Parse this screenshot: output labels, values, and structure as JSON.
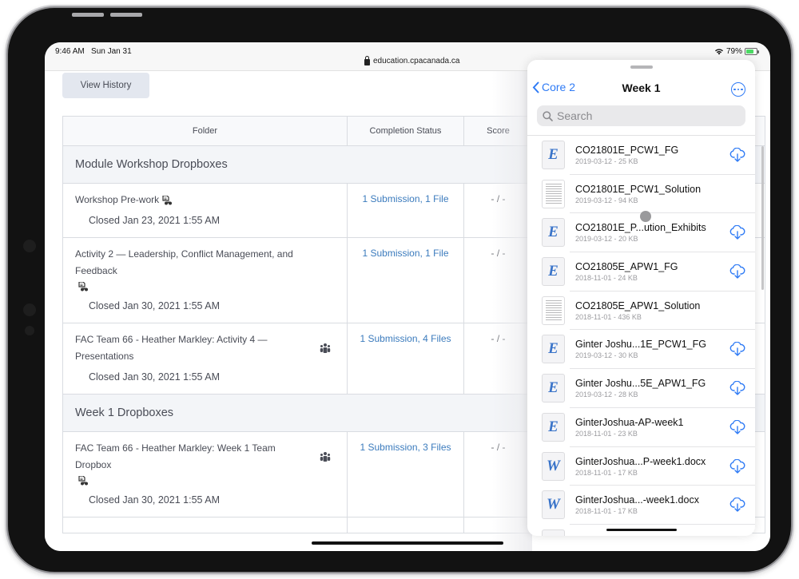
{
  "status_bar": {
    "time": "9:46 AM",
    "date": "Sun Jan 31",
    "url": "education.cpacanada.ca",
    "battery": "79%",
    "battery_level": 0.79
  },
  "page": {
    "view_history_label": "View History",
    "table": {
      "headers": [
        "Folder",
        "Completion Status",
        "Score"
      ],
      "sections": [
        {
          "title": "Module Workshop Dropboxes",
          "rows": [
            {
              "folder": "Workshop Pre-work",
              "closed": "Closed Jan 23, 2021 1:55 AM",
              "status": "1 Submission, 1 File",
              "score": "- / -",
              "icons": [
                "submission-icon"
              ]
            },
            {
              "folder": "Activity 2 — Leadership, Conflict Management, and Feedback",
              "closed": "Closed Jan 30, 2021 1:55 AM",
              "status": "1 Submission, 1 File",
              "score": "- / -",
              "icons": [
                "submission-icon"
              ]
            },
            {
              "folder": "FAC Team 66 - Heather Markley: Activity 4 — Presentations",
              "closed": "Closed Jan 30, 2021 1:55 AM",
              "status": "1 Submission, 4 Files",
              "score": "- / -",
              "icons": [
                "group-icon"
              ]
            }
          ]
        },
        {
          "title": "Week 1 Dropboxes",
          "rows": [
            {
              "folder": "FAC Team 66 - Heather Markley: Week 1 Team Dropbox",
              "closed": "Closed Jan 30, 2021 1:55 AM",
              "status": "1 Submission, 3 Files",
              "score": "- / -",
              "icons": [
                "group-icon",
                "submission-icon"
              ]
            }
          ]
        }
      ]
    }
  },
  "files_panel": {
    "back_label": "Core 2",
    "title": "Week 1",
    "search_placeholder": "Search",
    "files": [
      {
        "name": "CO21801E_PCW1_FG",
        "meta": "2019-03-12 - 25 KB",
        "thumb": "E",
        "cloud": true
      },
      {
        "name": "CO21801E_PCW1_Solution",
        "meta": "2019-03-12 - 94 KB",
        "thumb": "doc",
        "cloud": false
      },
      {
        "name": "CO21801E_P...ution_Exhibits",
        "meta": "2019-03-12 - 20 KB",
        "thumb": "E",
        "cloud": true
      },
      {
        "name": "CO21805E_APW1_FG",
        "meta": "2018-11-01 - 24 KB",
        "thumb": "E",
        "cloud": true
      },
      {
        "name": "CO21805E_APW1_Solution",
        "meta": "2018-11-01 - 436 KB",
        "thumb": "doc",
        "cloud": false
      },
      {
        "name": "Ginter Joshu...1E_PCW1_FG",
        "meta": "2019-03-12 - 30 KB",
        "thumb": "E",
        "cloud": true
      },
      {
        "name": "Ginter Joshu...5E_APW1_FG",
        "meta": "2019-03-12 - 28 KB",
        "thumb": "E",
        "cloud": true
      },
      {
        "name": "GinterJoshua-AP-week1",
        "meta": "2018-11-01 - 23 KB",
        "thumb": "E",
        "cloud": true
      },
      {
        "name": "GinterJoshua...P-week1.docx",
        "meta": "2018-11-01 - 17 KB",
        "thumb": "W",
        "cloud": true
      },
      {
        "name": "GinterJoshua...-week1.docx",
        "meta": "2018-11-01 - 17 KB",
        "thumb": "W",
        "cloud": true
      }
    ]
  },
  "colors": {
    "accent": "#2f7bf5",
    "link": "#3b7bbd",
    "file_glyph": "#3a74c9"
  }
}
